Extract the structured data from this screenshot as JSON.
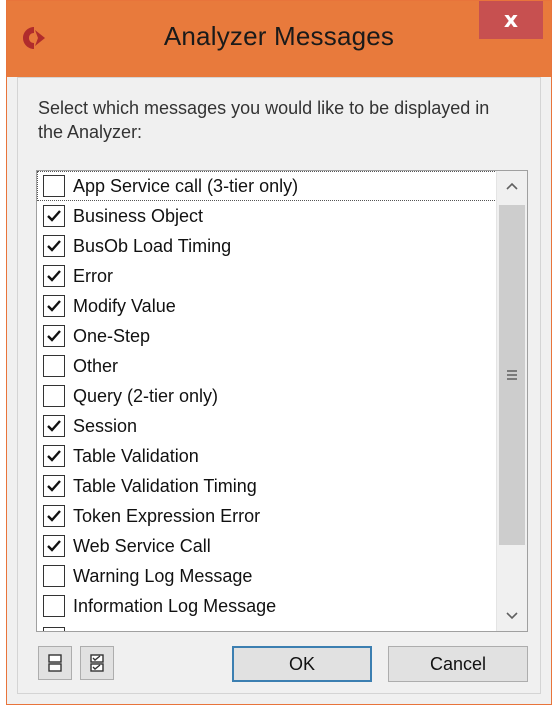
{
  "colors": {
    "titlebar_bg": "#e87a3c",
    "close_bg": "#c75050",
    "window_bg": "#f0f0f0",
    "default_button_border": "#3c7fb1"
  },
  "window": {
    "title": "Analyzer Messages",
    "app_icon": "cherwell-logo-icon",
    "close_label": "x"
  },
  "prompt": "Select which messages you would like to be displayed in the Analyzer:",
  "messages": [
    {
      "label": "App Service call (3-tier only)",
      "checked": false
    },
    {
      "label": "Business Object",
      "checked": true
    },
    {
      "label": "BusOb Load Timing",
      "checked": true
    },
    {
      "label": "Error",
      "checked": true
    },
    {
      "label": "Modify Value",
      "checked": true
    },
    {
      "label": "One-Step",
      "checked": true
    },
    {
      "label": "Other",
      "checked": false
    },
    {
      "label": "Query (2-tier only)",
      "checked": false
    },
    {
      "label": "Session",
      "checked": true
    },
    {
      "label": "Table Validation",
      "checked": true
    },
    {
      "label": "Table Validation Timing",
      "checked": true
    },
    {
      "label": "Token Expression Error",
      "checked": true
    },
    {
      "label": "Web Service Call",
      "checked": true
    },
    {
      "label": "Warning Log Message",
      "checked": false
    },
    {
      "label": "Information Log Message",
      "checked": false
    }
  ],
  "footer": {
    "select_none_icon": "uncheck-all-icon",
    "select_all_icon": "check-all-icon",
    "ok_label": "OK",
    "cancel_label": "Cancel"
  }
}
